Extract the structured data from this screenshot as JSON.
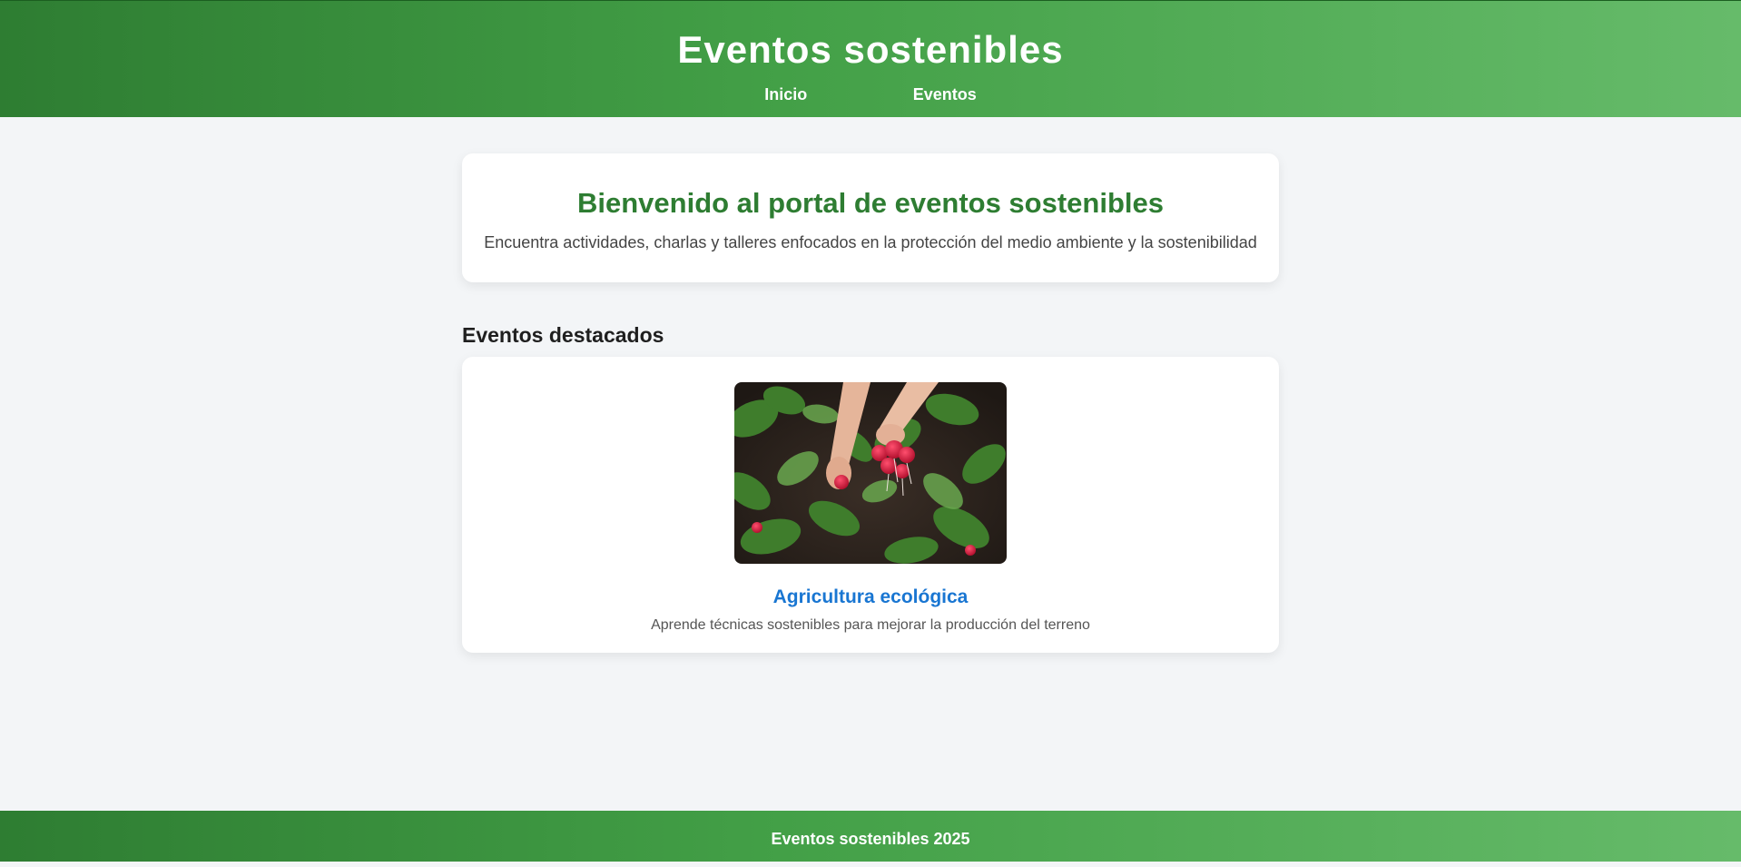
{
  "header": {
    "title": "Eventos sostenibles",
    "nav": [
      {
        "label": "Inicio"
      },
      {
        "label": "Eventos"
      }
    ]
  },
  "welcome": {
    "title": "Bienvenido al portal de eventos sostenibles",
    "subtitle": "Encuentra actividades, charlas y talleres enfocados en la protección del medio ambiente y la sostenibilidad"
  },
  "featured": {
    "section_title": "Eventos destacados",
    "events": [
      {
        "image": "radish-harvest-photo",
        "title": "Agricultura ecológica",
        "description": "Aprende técnicas sostenibles para mejorar la producción del terreno"
      }
    ]
  },
  "footer": {
    "text": "Eventos sostenibles 2025"
  },
  "colors": {
    "header_gradient_start": "#2e7d32",
    "header_gradient_end": "#66bb6a",
    "welcome_title": "#2e7d32",
    "event_title": "#1976d2",
    "background": "#f3f5f7"
  }
}
